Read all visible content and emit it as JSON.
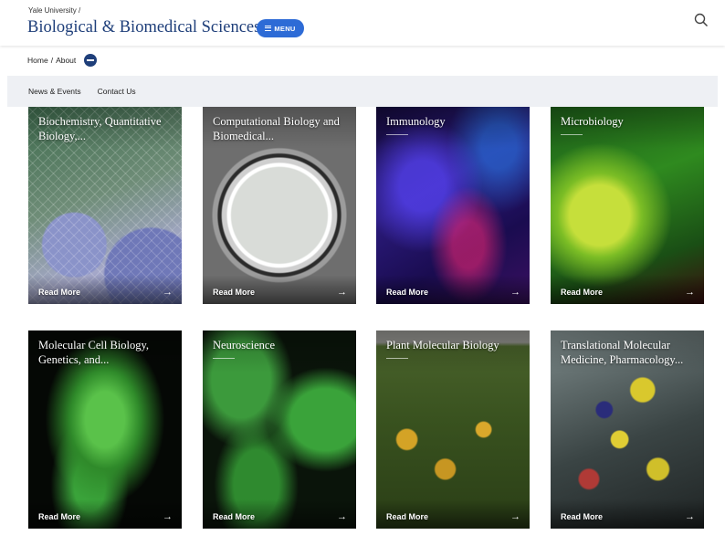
{
  "header": {
    "university": "Yale University /",
    "site_title": "Biological & Biomedical Sciences",
    "menu_label": "MENU"
  },
  "breadcrumb": {
    "home": "Home",
    "separator": "/",
    "current": "About"
  },
  "subnav": {
    "items": [
      "News & Events",
      "Contact Us"
    ]
  },
  "cards": [
    {
      "title": "Biochemistry, Quantitative Biology,...",
      "cta": "Read More",
      "arrow": "→"
    },
    {
      "title": "Computational Biology and Biomedical...",
      "cta": "Read More",
      "arrow": "→"
    },
    {
      "title": "Immunology",
      "cta": "Read More",
      "arrow": "→"
    },
    {
      "title": "Microbiology",
      "cta": "Read More",
      "arrow": "→"
    },
    {
      "title": "Molecular Cell Biology, Genetics, and...",
      "cta": "Read More",
      "arrow": "→"
    },
    {
      "title": "Neuroscience",
      "cta": "Read More",
      "arrow": "→"
    },
    {
      "title": "Plant Molecular Biology",
      "cta": "Read More",
      "arrow": "→"
    },
    {
      "title": "Translational Molecular Medicine, Pharmacology...",
      "cta": "Read More",
      "arrow": "→"
    }
  ],
  "colors": {
    "brand_navy": "#1f3f7a",
    "menu_blue": "#2d6bd6",
    "subnav_bg": "#eef0f4"
  },
  "icons": {
    "search": "search-icon",
    "menu": "hamburger-icon",
    "breadcrumb_toggle": "minus-circle-icon",
    "read_more": "arrow-right-icon"
  }
}
